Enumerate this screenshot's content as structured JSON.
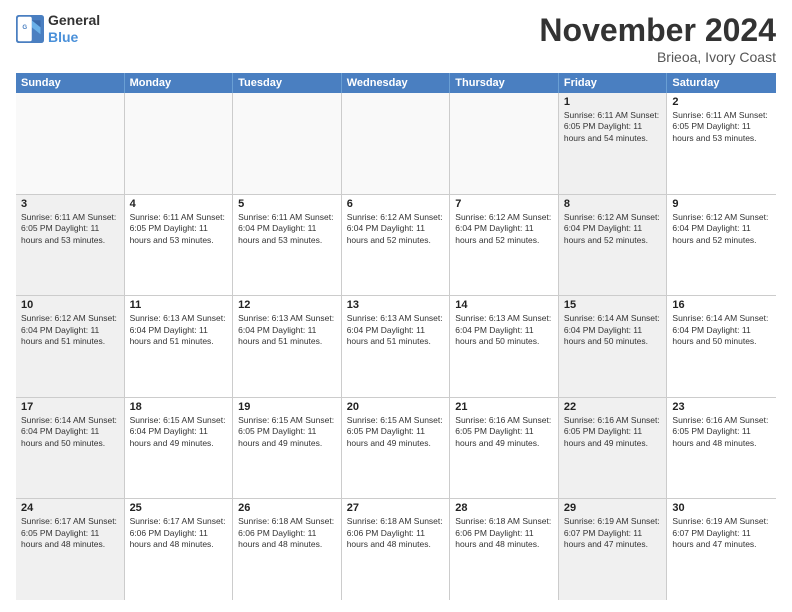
{
  "logo": {
    "line1": "General",
    "line2": "Blue"
  },
  "title": "November 2024",
  "location": "Brieoa, Ivory Coast",
  "days_header": [
    "Sunday",
    "Monday",
    "Tuesday",
    "Wednesday",
    "Thursday",
    "Friday",
    "Saturday"
  ],
  "weeks": [
    [
      {
        "day": "",
        "text": "",
        "empty": true
      },
      {
        "day": "",
        "text": "",
        "empty": true
      },
      {
        "day": "",
        "text": "",
        "empty": true
      },
      {
        "day": "",
        "text": "",
        "empty": true
      },
      {
        "day": "",
        "text": "",
        "empty": true
      },
      {
        "day": "1",
        "text": "Sunrise: 6:11 AM\nSunset: 6:05 PM\nDaylight: 11 hours\nand 54 minutes.",
        "shaded": true
      },
      {
        "day": "2",
        "text": "Sunrise: 6:11 AM\nSunset: 6:05 PM\nDaylight: 11 hours\nand 53 minutes.",
        "shaded": false
      }
    ],
    [
      {
        "day": "3",
        "text": "Sunrise: 6:11 AM\nSunset: 6:05 PM\nDaylight: 11 hours\nand 53 minutes.",
        "shaded": true
      },
      {
        "day": "4",
        "text": "Sunrise: 6:11 AM\nSunset: 6:05 PM\nDaylight: 11 hours\nand 53 minutes.",
        "shaded": false
      },
      {
        "day": "5",
        "text": "Sunrise: 6:11 AM\nSunset: 6:04 PM\nDaylight: 11 hours\nand 53 minutes.",
        "shaded": false
      },
      {
        "day": "6",
        "text": "Sunrise: 6:12 AM\nSunset: 6:04 PM\nDaylight: 11 hours\nand 52 minutes.",
        "shaded": false
      },
      {
        "day": "7",
        "text": "Sunrise: 6:12 AM\nSunset: 6:04 PM\nDaylight: 11 hours\nand 52 minutes.",
        "shaded": false
      },
      {
        "day": "8",
        "text": "Sunrise: 6:12 AM\nSunset: 6:04 PM\nDaylight: 11 hours\nand 52 minutes.",
        "shaded": true
      },
      {
        "day": "9",
        "text": "Sunrise: 6:12 AM\nSunset: 6:04 PM\nDaylight: 11 hours\nand 52 minutes.",
        "shaded": false
      }
    ],
    [
      {
        "day": "10",
        "text": "Sunrise: 6:12 AM\nSunset: 6:04 PM\nDaylight: 11 hours\nand 51 minutes.",
        "shaded": true
      },
      {
        "day": "11",
        "text": "Sunrise: 6:13 AM\nSunset: 6:04 PM\nDaylight: 11 hours\nand 51 minutes.",
        "shaded": false
      },
      {
        "day": "12",
        "text": "Sunrise: 6:13 AM\nSunset: 6:04 PM\nDaylight: 11 hours\nand 51 minutes.",
        "shaded": false
      },
      {
        "day": "13",
        "text": "Sunrise: 6:13 AM\nSunset: 6:04 PM\nDaylight: 11 hours\nand 51 minutes.",
        "shaded": false
      },
      {
        "day": "14",
        "text": "Sunrise: 6:13 AM\nSunset: 6:04 PM\nDaylight: 11 hours\nand 50 minutes.",
        "shaded": false
      },
      {
        "day": "15",
        "text": "Sunrise: 6:14 AM\nSunset: 6:04 PM\nDaylight: 11 hours\nand 50 minutes.",
        "shaded": true
      },
      {
        "day": "16",
        "text": "Sunrise: 6:14 AM\nSunset: 6:04 PM\nDaylight: 11 hours\nand 50 minutes.",
        "shaded": false
      }
    ],
    [
      {
        "day": "17",
        "text": "Sunrise: 6:14 AM\nSunset: 6:04 PM\nDaylight: 11 hours\nand 50 minutes.",
        "shaded": true
      },
      {
        "day": "18",
        "text": "Sunrise: 6:15 AM\nSunset: 6:04 PM\nDaylight: 11 hours\nand 49 minutes.",
        "shaded": false
      },
      {
        "day": "19",
        "text": "Sunrise: 6:15 AM\nSunset: 6:05 PM\nDaylight: 11 hours\nand 49 minutes.",
        "shaded": false
      },
      {
        "day": "20",
        "text": "Sunrise: 6:15 AM\nSunset: 6:05 PM\nDaylight: 11 hours\nand 49 minutes.",
        "shaded": false
      },
      {
        "day": "21",
        "text": "Sunrise: 6:16 AM\nSunset: 6:05 PM\nDaylight: 11 hours\nand 49 minutes.",
        "shaded": false
      },
      {
        "day": "22",
        "text": "Sunrise: 6:16 AM\nSunset: 6:05 PM\nDaylight: 11 hours\nand 49 minutes.",
        "shaded": true
      },
      {
        "day": "23",
        "text": "Sunrise: 6:16 AM\nSunset: 6:05 PM\nDaylight: 11 hours\nand 48 minutes.",
        "shaded": false
      }
    ],
    [
      {
        "day": "24",
        "text": "Sunrise: 6:17 AM\nSunset: 6:05 PM\nDaylight: 11 hours\nand 48 minutes.",
        "shaded": true
      },
      {
        "day": "25",
        "text": "Sunrise: 6:17 AM\nSunset: 6:06 PM\nDaylight: 11 hours\nand 48 minutes.",
        "shaded": false
      },
      {
        "day": "26",
        "text": "Sunrise: 6:18 AM\nSunset: 6:06 PM\nDaylight: 11 hours\nand 48 minutes.",
        "shaded": false
      },
      {
        "day": "27",
        "text": "Sunrise: 6:18 AM\nSunset: 6:06 PM\nDaylight: 11 hours\nand 48 minutes.",
        "shaded": false
      },
      {
        "day": "28",
        "text": "Sunrise: 6:18 AM\nSunset: 6:06 PM\nDaylight: 11 hours\nand 48 minutes.",
        "shaded": false
      },
      {
        "day": "29",
        "text": "Sunrise: 6:19 AM\nSunset: 6:07 PM\nDaylight: 11 hours\nand 47 minutes.",
        "shaded": true
      },
      {
        "day": "30",
        "text": "Sunrise: 6:19 AM\nSunset: 6:07 PM\nDaylight: 11 hours\nand 47 minutes.",
        "shaded": false
      }
    ]
  ]
}
